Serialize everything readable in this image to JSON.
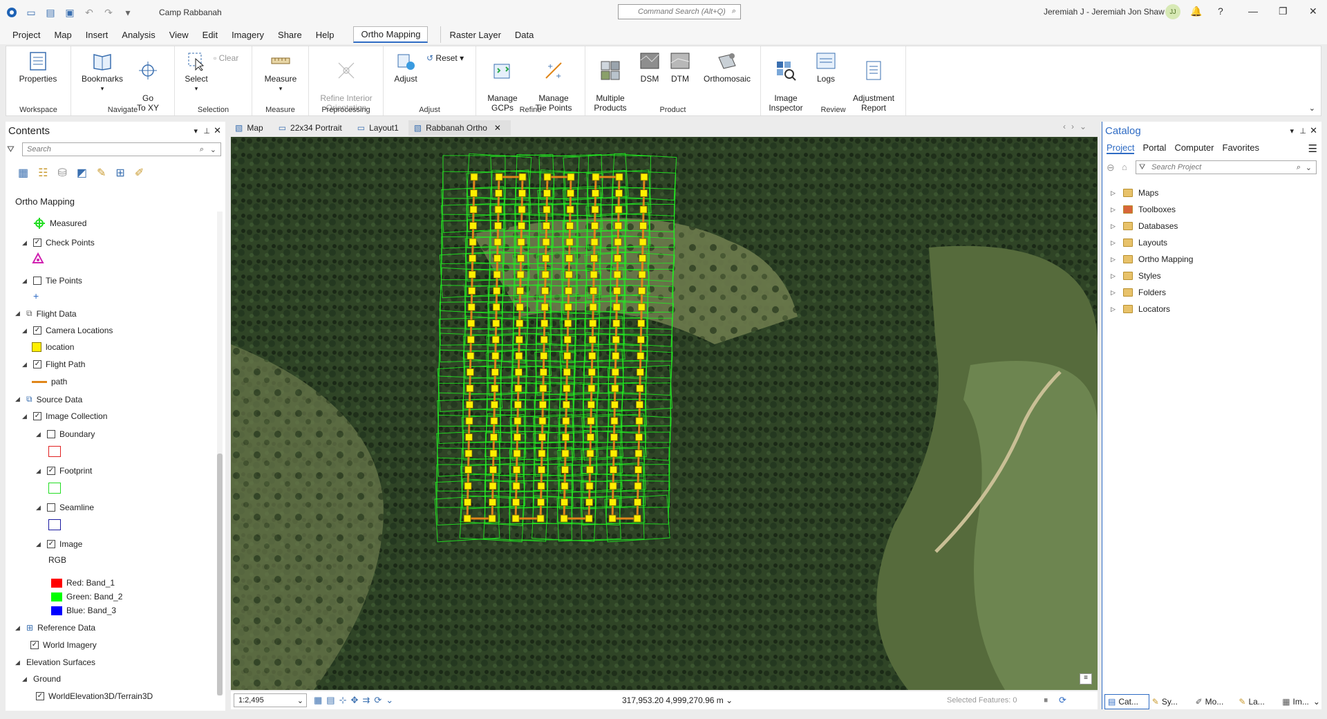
{
  "titlebar": {
    "project_name": "Camp Rabbanah",
    "command_search_placeholder": "Command Search (Alt+Q)",
    "user": "Jeremiah J - Jeremiah Jon Shaw",
    "avatar_initials": "JJ"
  },
  "menu": [
    "Project",
    "Map",
    "Insert",
    "Analysis",
    "View",
    "Edit",
    "Imagery",
    "Share",
    "Help"
  ],
  "menu_active": "Ortho Mapping",
  "menu_context": [
    "Raster Layer",
    "Data"
  ],
  "ribbon": {
    "workspace": {
      "label": "Workspace",
      "tools": [
        "Properties"
      ]
    },
    "navigate": {
      "label": "Navigate",
      "tools": [
        "Bookmarks",
        "Go\nTo XY"
      ]
    },
    "selection": {
      "label": "Selection",
      "select": "Select",
      "clear": "Clear"
    },
    "measure": {
      "label": "Measure",
      "tools": [
        "Measure"
      ]
    },
    "preprocessing": {
      "label": "Preprocessing",
      "tools": [
        "Refine Interior\nOrientation"
      ]
    },
    "adjust": {
      "label": "Adjust",
      "adjust": "Adjust",
      "reset": "Reset"
    },
    "refine": {
      "label": "Refine",
      "tools": [
        "Manage\nGCPs",
        "Manage\nTie Points"
      ]
    },
    "product": {
      "label": "Product",
      "tools": [
        "Multiple\nProducts",
        "DSM",
        "DTM",
        "Orthomosaic"
      ]
    },
    "review": {
      "label": "Review",
      "tools": [
        "Image\nInspector",
        "Logs",
        "Adjustment\nReport"
      ]
    }
  },
  "contents": {
    "title": "Contents",
    "search_placeholder": "Search",
    "map_name": "Ortho Mapping",
    "items": [
      {
        "label": "Measured",
        "kind": "legend"
      },
      {
        "label": "Check Points",
        "checked": true
      },
      {
        "label": "Tie Points",
        "checked": false
      },
      {
        "label": "Flight Data",
        "kind": "group"
      },
      {
        "label": "Camera Locations",
        "checked": true
      },
      {
        "label": "location",
        "kind": "legend"
      },
      {
        "label": "Flight Path",
        "checked": true
      },
      {
        "label": "path",
        "kind": "legend"
      },
      {
        "label": "Source Data",
        "kind": "group"
      },
      {
        "label": "Image Collection",
        "checked": true
      },
      {
        "label": "Boundary",
        "checked": false
      },
      {
        "label": "Footprint",
        "checked": true
      },
      {
        "label": "Seamline",
        "checked": false
      },
      {
        "label": "Image",
        "checked": true
      },
      {
        "label": "RGB",
        "kind": "legend"
      },
      {
        "label": "Red:   Band_1",
        "kind": "legend"
      },
      {
        "label": "Green: Band_2",
        "kind": "legend"
      },
      {
        "label": "Blue:  Band_3",
        "kind": "legend"
      },
      {
        "label": "Reference Data",
        "kind": "group"
      },
      {
        "label": "World Imagery",
        "checked": true
      },
      {
        "label": "Elevation Surfaces",
        "kind": "group"
      },
      {
        "label": "Ground",
        "kind": "group"
      },
      {
        "label": "WorldElevation3D/Terrain3D",
        "checked": true
      }
    ]
  },
  "view_tabs": [
    "Map",
    "22x34 Portrait",
    "Layout1",
    "Rabbanah Ortho"
  ],
  "status": {
    "scale": "1:2,495",
    "coords": "317,953.20 4,999,270.96 m",
    "selected": "Selected Features: 0"
  },
  "catalog": {
    "title": "Catalog",
    "tabs": [
      "Project",
      "Portal",
      "Computer",
      "Favorites"
    ],
    "search_placeholder": "Search Project",
    "items": [
      "Maps",
      "Toolboxes",
      "Databases",
      "Layouts",
      "Ortho Mapping",
      "Styles",
      "Folders",
      "Locators"
    ]
  },
  "bottom_tabs": [
    "Cat...",
    "Sy...",
    "Mo...",
    "La...",
    "Im..."
  ],
  "colors": {
    "accent": "#2e6bc4",
    "footprint": "#22ee22",
    "camera": "#ffef00",
    "path": "#e0861a"
  }
}
